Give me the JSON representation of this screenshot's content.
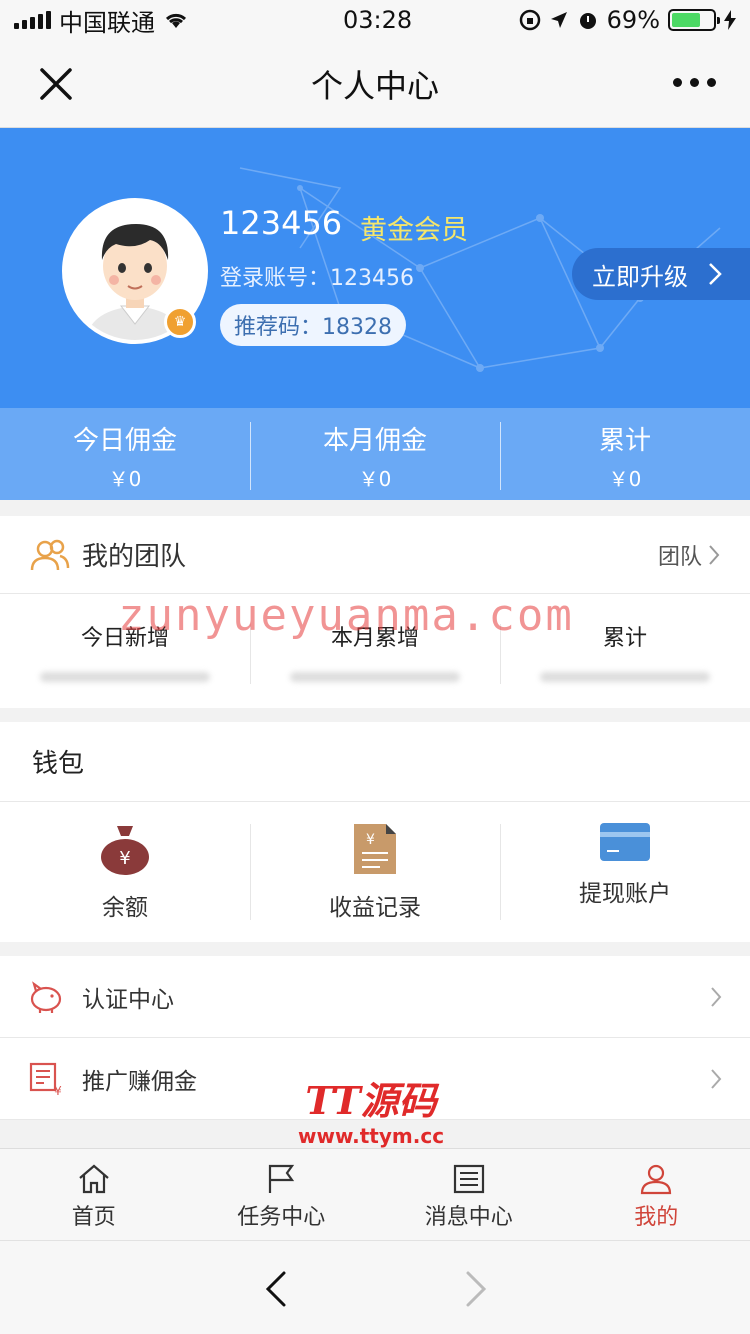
{
  "status_bar": {
    "carrier": "中国联通",
    "time": "03:28",
    "battery_percent": "69%",
    "battery_level": 0.69
  },
  "nav": {
    "title": "个人中心"
  },
  "profile": {
    "username": "123456",
    "member_level": "黄金会员",
    "account_label": "登录账号：123456",
    "referral_label": "推荐码：18328",
    "upgrade_label": "立即升级"
  },
  "commission": [
    {
      "label": "今日佣金",
      "value": "￥0"
    },
    {
      "label": "本月佣金",
      "value": "￥0"
    },
    {
      "label": "累计",
      "value": "￥0"
    }
  ],
  "team": {
    "title": "我的团队",
    "link": "团队",
    "stats": [
      "今日新增",
      "本月累增",
      "累计"
    ]
  },
  "wallet": {
    "title": "钱包",
    "items": [
      {
        "label": "余额",
        "icon": "money-bag-icon"
      },
      {
        "label": "收益记录",
        "icon": "income-record-icon"
      },
      {
        "label": "提现账户",
        "icon": "card-icon"
      }
    ]
  },
  "menu": [
    {
      "label": "认证中心",
      "icon": "piggy-bank-icon"
    },
    {
      "label": "推广赚佣金",
      "icon": "commission-icon"
    }
  ],
  "tabs": [
    {
      "label": "首页",
      "icon": "home-icon",
      "active": false
    },
    {
      "label": "任务中心",
      "icon": "flag-icon",
      "active": false
    },
    {
      "label": "消息中心",
      "icon": "message-icon",
      "active": false
    },
    {
      "label": "我的",
      "icon": "user-icon",
      "active": true
    }
  ],
  "watermarks": {
    "site1": "zunyueyuanma.com",
    "brand": "TT源码",
    "site2": "www.ttym.cc"
  },
  "colors": {
    "primary_blue": "#3d8ef2",
    "commission_blue": "#6aa9f5",
    "gold": "#f5e66b",
    "active_tab": "#d0453a"
  }
}
